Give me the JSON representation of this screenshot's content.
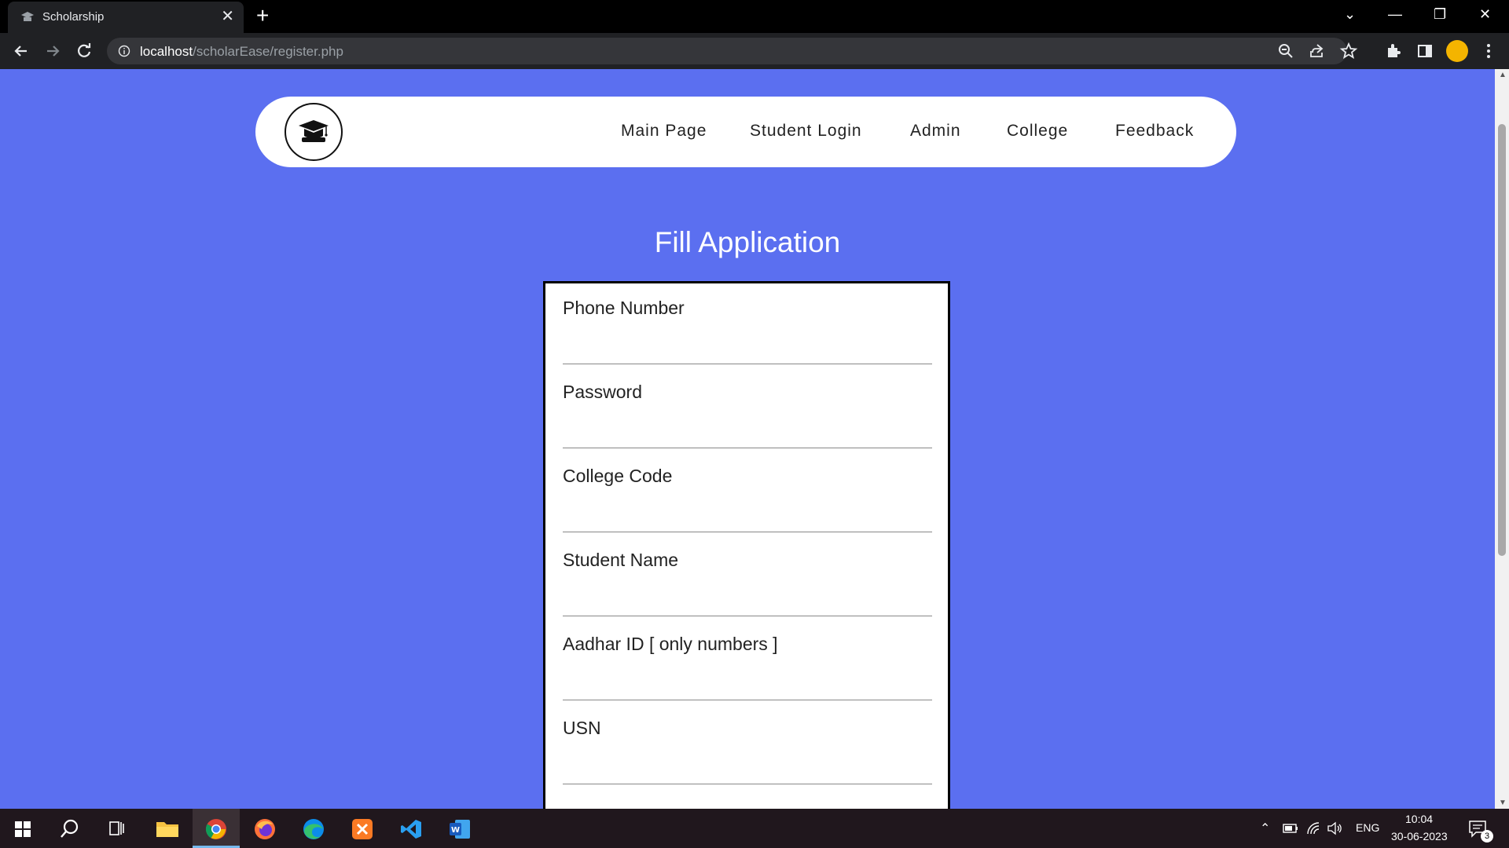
{
  "browser": {
    "tab_title": "Scholarship",
    "url_host": "localhost",
    "url_path": "/scholarEase/register.php"
  },
  "nav": {
    "links": [
      "Main Page",
      "Student Login",
      "Admin",
      "College",
      "Feedback"
    ]
  },
  "form": {
    "title": "Fill Application",
    "fields": [
      {
        "label": "Phone Number",
        "value": ""
      },
      {
        "label": "Password",
        "value": ""
      },
      {
        "label": "College Code",
        "value": ""
      },
      {
        "label": "Student Name",
        "value": ""
      },
      {
        "label": "Aadhar ID [ only numbers ]",
        "value": ""
      },
      {
        "label": "USN",
        "value": ""
      }
    ]
  },
  "taskbar": {
    "language": "ENG",
    "time": "10:04",
    "date": "30-06-2023",
    "notification_count": "3"
  },
  "colors": {
    "page_background": "#5b6ff0",
    "navbar_background": "#ffffff"
  }
}
